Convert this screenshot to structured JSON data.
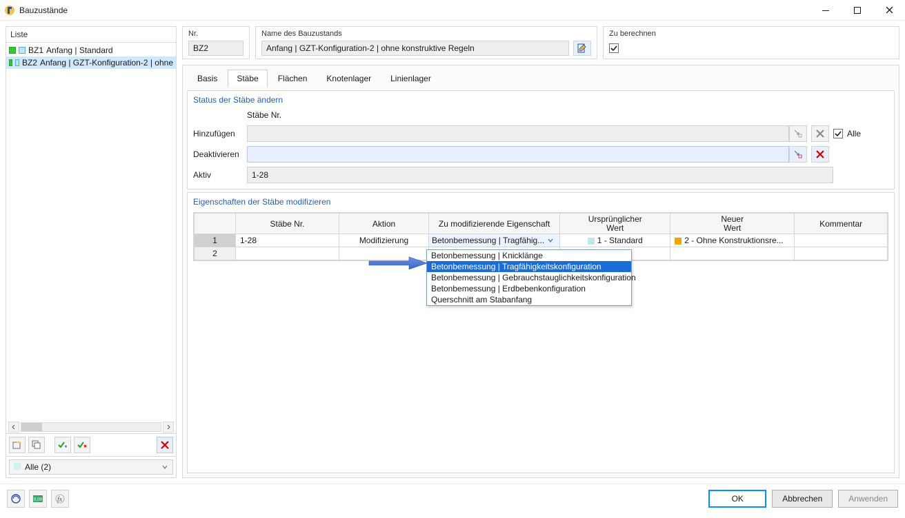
{
  "titlebar": {
    "title": "Bauzustände"
  },
  "leftPane": {
    "header": "Liste",
    "items": [
      {
        "id": "BZ1",
        "name": "Anfang | Standard"
      },
      {
        "id": "BZ2",
        "name": "Anfang | GZT-Konfiguration-2 | ohne"
      }
    ],
    "filter": "Alle (2)"
  },
  "top": {
    "nrLabel": "Nr.",
    "nrValue": "BZ2",
    "nameLabel": "Name des Bauzustands",
    "nameValue": "Anfang | GZT-Konfiguration-2 | ohne konstruktive Regeln",
    "calcLabel": "Zu berechnen"
  },
  "tabs": {
    "basis": "Basis",
    "staebe": "Stäbe",
    "flaechen": "Flächen",
    "knotenlager": "Knotenlager",
    "linienlager": "Linienlager"
  },
  "status": {
    "sectionTitle": "Status der Stäbe ändern",
    "colHeader": "Stäbe Nr.",
    "addLabel": "Hinzufügen",
    "addValue": "",
    "allLabel": "Alle",
    "deactLabel": "Deaktivieren",
    "deactValue": "",
    "activeLabel": "Aktiv",
    "activeValue": "1-28"
  },
  "modify": {
    "sectionTitle": "Eigenschaften der Stäbe modifizieren",
    "headers": {
      "staebe": "Stäbe Nr.",
      "aktion": "Aktion",
      "eigenschaft": "Zu modifizierende Eigenschaft",
      "ursprung1": "Ursprünglicher",
      "ursprung2": "Wert",
      "neuer1": "Neuer",
      "neuer2": "Wert",
      "kommentar": "Kommentar"
    },
    "rows": [
      {
        "num": "1",
        "staebe": "1-28",
        "aktion": "Modifizierung",
        "eigenschaft": "Betonbemessung | Tragfähig...",
        "ursprung": "1 - Standard",
        "neuer": "2 - Ohne Konstruktionsre...",
        "kommentar": ""
      },
      {
        "num": "2",
        "staebe": "",
        "aktion": "",
        "eigenschaft": "",
        "ursprung": "",
        "neuer": "",
        "kommentar": ""
      }
    ],
    "dropdown": [
      "Betonbemessung | Knicklänge",
      "Betonbemessung | Tragfähigkeitskonfiguration",
      "Betonbemessung | Gebrauchstauglichkeitskonfiguration",
      "Betonbemessung | Erdbebenkonfiguration",
      "Querschnitt am Stabanfang"
    ],
    "dropdownSelectedIndex": 1
  },
  "buttons": {
    "ok": "OK",
    "cancel": "Abbrechen",
    "apply": "Anwenden"
  }
}
